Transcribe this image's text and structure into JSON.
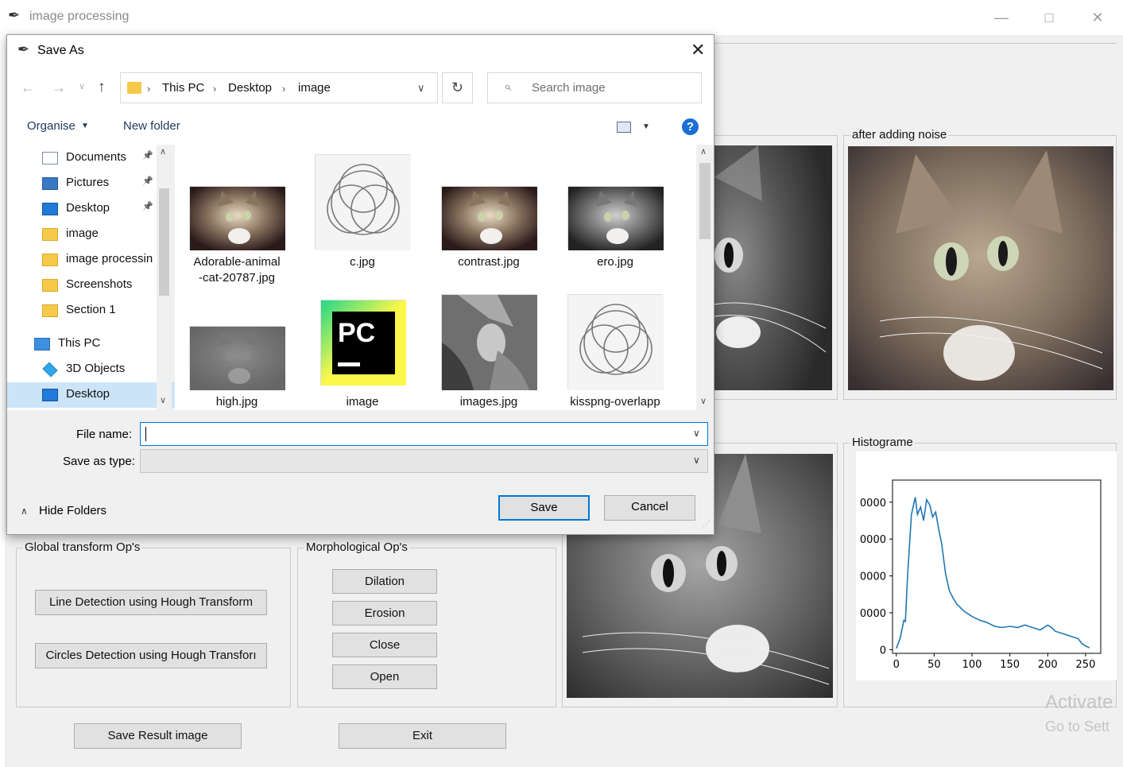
{
  "main": {
    "title": "image processing",
    "noise_group_label": "after adding noise",
    "hist_group_label": "Histograme",
    "global_group_label": "Global transform Op's",
    "morph_group_label": "Morphological Op's",
    "global_buttons": [
      "Line Detection using Hough Transform",
      "Circles Detection using Hough Transforı"
    ],
    "morph_buttons": [
      "Dilation",
      "Erosion",
      "Close",
      "Open"
    ],
    "save_result_label": "Save Result image",
    "exit_label": "Exit",
    "watermark_line1": "Activate",
    "watermark_line2": "Go to Sett"
  },
  "histogram": {
    "y_ticks": [
      "0000",
      "0000",
      "0000",
      "0000",
      "0"
    ],
    "x_ticks": [
      "0",
      "50",
      "100",
      "150",
      "200",
      "250"
    ],
    "line_color": "#1f77b4"
  },
  "chart_data": {
    "type": "line",
    "x": [
      0,
      5,
      10,
      12,
      15,
      20,
      25,
      28,
      32,
      36,
      40,
      44,
      48,
      52,
      56,
      60,
      65,
      70,
      75,
      80,
      90,
      100,
      110,
      120,
      130,
      140,
      150,
      160,
      170,
      175,
      180,
      190,
      200,
      205,
      210,
      220,
      230,
      240,
      245,
      250,
      255
    ],
    "y": [
      100,
      900,
      2400,
      2300,
      6200,
      11000,
      12400,
      11000,
      11600,
      10500,
      12200,
      11800,
      10800,
      11200,
      9800,
      8600,
      6200,
      4800,
      4200,
      3700,
      3100,
      2700,
      2400,
      2200,
      1900,
      1800,
      1900,
      1800,
      2000,
      1900,
      1800,
      1600,
      2000,
      1800,
      1500,
      1300,
      1100,
      900,
      500,
      300,
      150
    ],
    "x_ticks": [
      "0",
      "50",
      "100",
      "150",
      "200",
      "250"
    ],
    "xlim": [
      -5,
      270
    ],
    "ylim": [
      -300,
      13800
    ],
    "grid": false,
    "line_color": "#1f77b4"
  },
  "dialog": {
    "title": "Save As",
    "path": [
      "This PC",
      "Desktop",
      "image"
    ],
    "search_placeholder": "Search image",
    "organise_label": "Organise",
    "new_folder_label": "New folder",
    "help_glyph": "?",
    "nav_items": [
      {
        "label": "Documents",
        "icon": "documents-icon",
        "pinned": true
      },
      {
        "label": "Pictures",
        "icon": "pictures-icon",
        "pinned": true
      },
      {
        "label": "Desktop",
        "icon": "desktop-icon",
        "pinned": true
      },
      {
        "label": "image",
        "icon": "folder-icon",
        "pinned": false
      },
      {
        "label": "image processin",
        "icon": "folder-icon",
        "pinned": false
      },
      {
        "label": "Screenshots",
        "icon": "folder-icon",
        "pinned": false
      },
      {
        "label": "Section 1",
        "icon": "folder-icon",
        "pinned": false
      },
      {
        "label": "This PC",
        "icon": "pc-icon",
        "pinned": false
      },
      {
        "label": "3D Objects",
        "icon": "cube-icon",
        "pinned": false
      },
      {
        "label": "Desktop",
        "icon": "desktop-icon",
        "pinned": false
      }
    ],
    "files": [
      {
        "name": "Adorable-animal\n-cat-20787.jpg",
        "kind": "cat"
      },
      {
        "name": "c.jpg",
        "kind": "circles"
      },
      {
        "name": "contrast.jpg",
        "kind": "cat"
      },
      {
        "name": "ero.jpg",
        "kind": "cat-gray"
      },
      {
        "name": "high.jpg",
        "kind": "cat-faint"
      },
      {
        "name": "image",
        "kind": "pycharm"
      },
      {
        "name": "images.jpg",
        "kind": "lena"
      },
      {
        "name": "kisspng-overlapp",
        "kind": "circles"
      }
    ],
    "pycharm_text": "PC",
    "file_name_label": "File name:",
    "file_name_value": "",
    "save_type_label": "Save as type:",
    "save_type_value": "",
    "hide_folders_label": "Hide Folders",
    "save_label": "Save",
    "cancel_label": "Cancel"
  }
}
